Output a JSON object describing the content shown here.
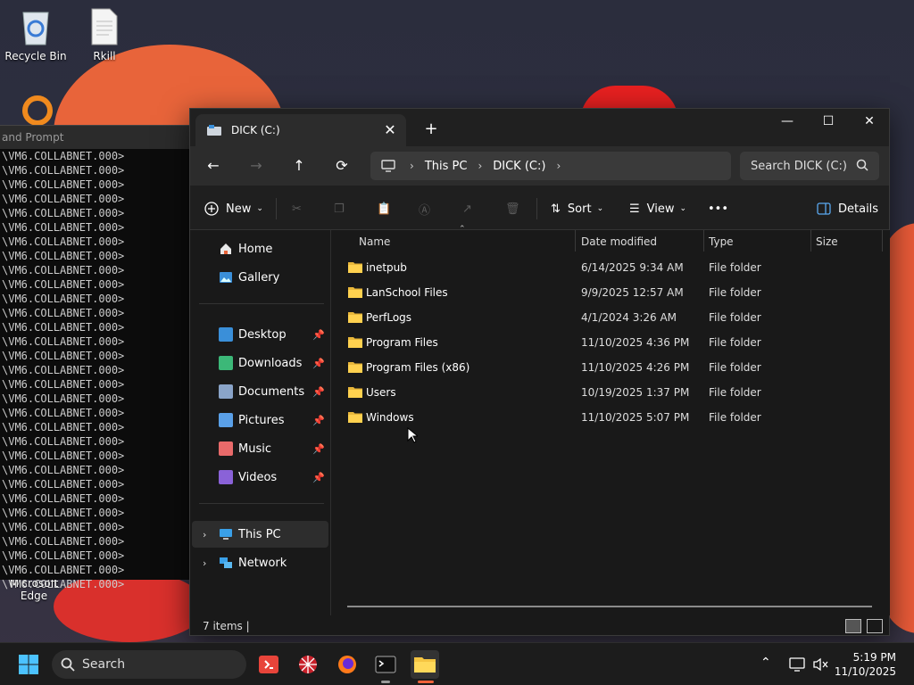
{
  "desktop": {
    "icons": [
      {
        "label": "Recycle Bin"
      },
      {
        "label": "Rkill"
      },
      {
        "label": "Microsoft Edge"
      }
    ]
  },
  "cmd": {
    "title": "and Prompt",
    "line": "\\VM6.COLLABNET.000>",
    "line_count": 31
  },
  "explorer": {
    "tab_title": "DICK (C:)",
    "window_controls": {
      "minimize": "—",
      "maximize": "☐",
      "close": "✕"
    },
    "address": {
      "root": "This PC",
      "drive": "DICK (C:)"
    },
    "search_placeholder": "Search DICK (C:)",
    "toolbar": {
      "new_label": "New",
      "sort_label": "Sort",
      "view_label": "View",
      "more_label": "•••",
      "details_label": "Details"
    },
    "nav": {
      "home": "Home",
      "gallery": "Gallery",
      "quick": [
        {
          "label": "Desktop",
          "icon": "desktop-icon",
          "color": "#3a8fd9"
        },
        {
          "label": "Downloads",
          "icon": "download-icon",
          "color": "#3cb878"
        },
        {
          "label": "Documents",
          "icon": "document-icon",
          "color": "#8aa4c8"
        },
        {
          "label": "Pictures",
          "icon": "picture-icon",
          "color": "#5aa0e8"
        },
        {
          "label": "Music",
          "icon": "music-icon",
          "color": "#e86a6a"
        },
        {
          "label": "Videos",
          "icon": "video-icon",
          "color": "#8a62d8"
        }
      ],
      "this_pc": "This PC",
      "network": "Network"
    },
    "columns": {
      "name": "Name",
      "date": "Date modified",
      "type": "Type",
      "size": "Size"
    },
    "files": [
      {
        "name": "inetpub",
        "date": "6/14/2025 9:34 AM",
        "type": "File folder"
      },
      {
        "name": "LanSchool Files",
        "date": "9/9/2025 12:57 AM",
        "type": "File folder"
      },
      {
        "name": "PerfLogs",
        "date": "4/1/2024 3:26 AM",
        "type": "File folder"
      },
      {
        "name": "Program Files",
        "date": "11/10/2025 4:36 PM",
        "type": "File folder"
      },
      {
        "name": "Program Files (x86)",
        "date": "11/10/2025 4:26 PM",
        "type": "File folder"
      },
      {
        "name": "Users",
        "date": "10/19/2025 1:37 PM",
        "type": "File folder"
      },
      {
        "name": "Windows",
        "date": "11/10/2025 5:07 PM",
        "type": "File folder"
      }
    ],
    "status": "7 items  |"
  },
  "taskbar": {
    "search_label": "Search",
    "time": "5:19 PM",
    "date": "11/10/2025",
    "accent": "#f0623a"
  }
}
